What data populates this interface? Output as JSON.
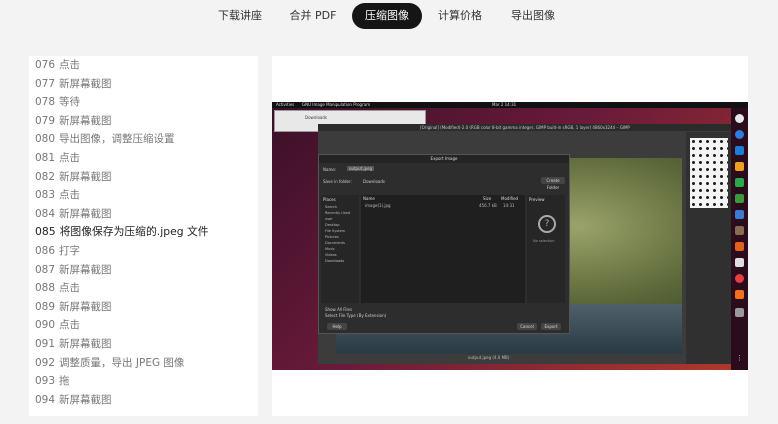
{
  "nav": {
    "tabs": [
      {
        "label": "下载讲座"
      },
      {
        "label": "合并 PDF"
      },
      {
        "label": "压缩图像"
      },
      {
        "label": "计算价格"
      },
      {
        "label": "导出图像"
      }
    ],
    "active_index": 2
  },
  "steps": [
    {
      "num": "076",
      "text": "点击"
    },
    {
      "num": "077",
      "text": "新屏幕截图"
    },
    {
      "num": "078",
      "text": "等待"
    },
    {
      "num": "079",
      "text": "新屏幕截图"
    },
    {
      "num": "080",
      "text": "导出图像，调整压缩设置"
    },
    {
      "num": "081",
      "text": "点击"
    },
    {
      "num": "082",
      "text": "新屏幕截图"
    },
    {
      "num": "083",
      "text": "点击"
    },
    {
      "num": "084",
      "text": "新屏幕截图"
    },
    {
      "num": "085",
      "text": "将图像保存为压缩的.jpeg 文件"
    },
    {
      "num": "086",
      "text": "打字"
    },
    {
      "num": "087",
      "text": "新屏幕截图"
    },
    {
      "num": "088",
      "text": "点击"
    },
    {
      "num": "089",
      "text": "新屏幕截图"
    },
    {
      "num": "090",
      "text": "点击"
    },
    {
      "num": "091",
      "text": "新屏幕截图"
    },
    {
      "num": "092",
      "text": "调整质量，导出 JPEG 图像"
    },
    {
      "num": "093",
      "text": "拖"
    },
    {
      "num": "094",
      "text": "新屏幕截图"
    }
  ],
  "active_step": "085",
  "screenshot": {
    "topbar_left": "Activities",
    "topbar_app": "GNU Image Manipulation Program",
    "topbar_clock": "Mar 2  14:31",
    "filewin_label": "Downloads",
    "gimp_title": "[Original] (Modified)-2.0 (RGB color 8-bit gamma integer, GIMP built-in sRGB, 1 layer) 4860x3244 – GIMP",
    "dialog": {
      "title": "Export Image",
      "name_label": "Name:",
      "name_value": "output.jpeg",
      "save_in_label": "Save in folder:",
      "folder": "Downloads",
      "create_folder": "Create Folder",
      "places_header": "Places",
      "places": [
        "Search",
        "Recently Used",
        "user",
        "Desktop",
        "File System",
        "Pictures",
        "Documents",
        "Music",
        "Videos",
        "Downloads"
      ],
      "columns": [
        "Name",
        "Size",
        "Modified"
      ],
      "file": {
        "name": "image(1).jpg",
        "size": "456.7 kB",
        "modified": "14:31"
      },
      "preview_label": "Preview",
      "no_selection": "No selection",
      "show_all_files": "Show All Files",
      "select_type": "Select File Type (By Extension)",
      "help": "Help",
      "cancel": "Cancel",
      "export": "Export"
    },
    "status": "output.jpeg (4.0 MB)"
  },
  "colors": {
    "active_tab_bg": "#151515",
    "active_tab_fg": "#ffffff",
    "page_bg": "#f3f3f3"
  }
}
